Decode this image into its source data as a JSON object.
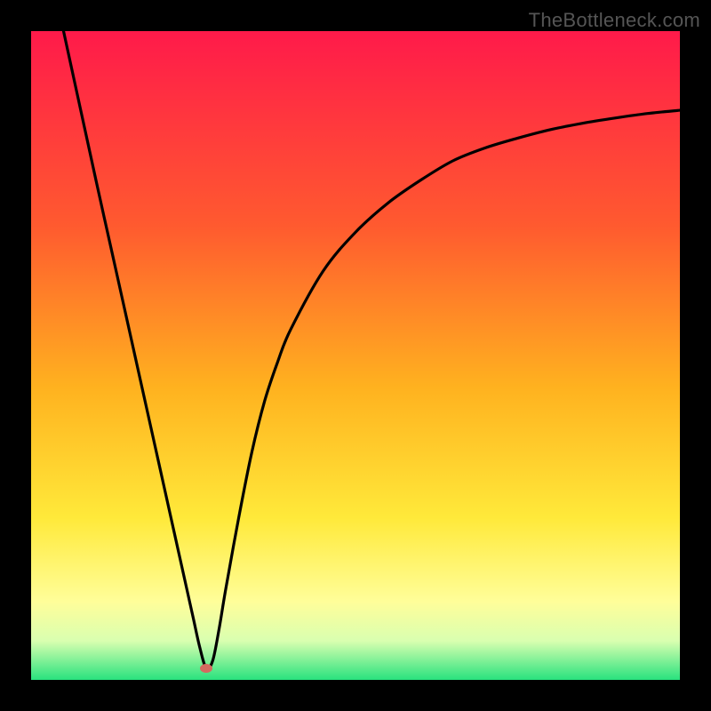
{
  "watermark": "TheBottleneck.com",
  "gradient": {
    "top": "#ff1a4a",
    "upper_mid": "#ff7a2a",
    "mid": "#ffd21f",
    "lower_mid": "#fffd75",
    "band_light": "#efffc5",
    "bottom": "#29e27e"
  },
  "marker": {
    "x_pct": 27.0,
    "y_pct": 98.2,
    "color": "#d46a5f"
  },
  "chart_data": {
    "type": "line",
    "title": "",
    "xlabel": "",
    "ylabel": "",
    "xlim": [
      0,
      100
    ],
    "ylim": [
      0,
      100
    ],
    "series": [
      {
        "name": "bottleneck-curve",
        "x": [
          5,
          10,
          12,
          15,
          18,
          20,
          22,
          24,
          25,
          26,
          27,
          28,
          29,
          30,
          32,
          34,
          36,
          38,
          40,
          45,
          50,
          55,
          60,
          65,
          70,
          75,
          80,
          85,
          90,
          95,
          100
        ],
        "values": [
          100,
          77,
          68,
          54.5,
          41,
          32,
          23,
          14,
          9.5,
          5,
          1.8,
          3,
          8,
          14,
          25,
          35,
          43,
          49,
          54,
          63,
          69,
          73.5,
          77,
          80,
          82,
          83.5,
          84.8,
          85.8,
          86.6,
          87.3,
          87.8
        ]
      }
    ],
    "annotations": [
      {
        "name": "minimum-marker",
        "x": 27,
        "y": 1.8
      }
    ],
    "background_gradient": [
      {
        "stop": 0.0,
        "color": "#ff1a4a"
      },
      {
        "stop": 0.3,
        "color": "#ff5a2f"
      },
      {
        "stop": 0.55,
        "color": "#ffb21f"
      },
      {
        "stop": 0.75,
        "color": "#ffe93a"
      },
      {
        "stop": 0.88,
        "color": "#fffe9a"
      },
      {
        "stop": 0.94,
        "color": "#d9ffb0"
      },
      {
        "stop": 1.0,
        "color": "#29e27e"
      }
    ]
  }
}
